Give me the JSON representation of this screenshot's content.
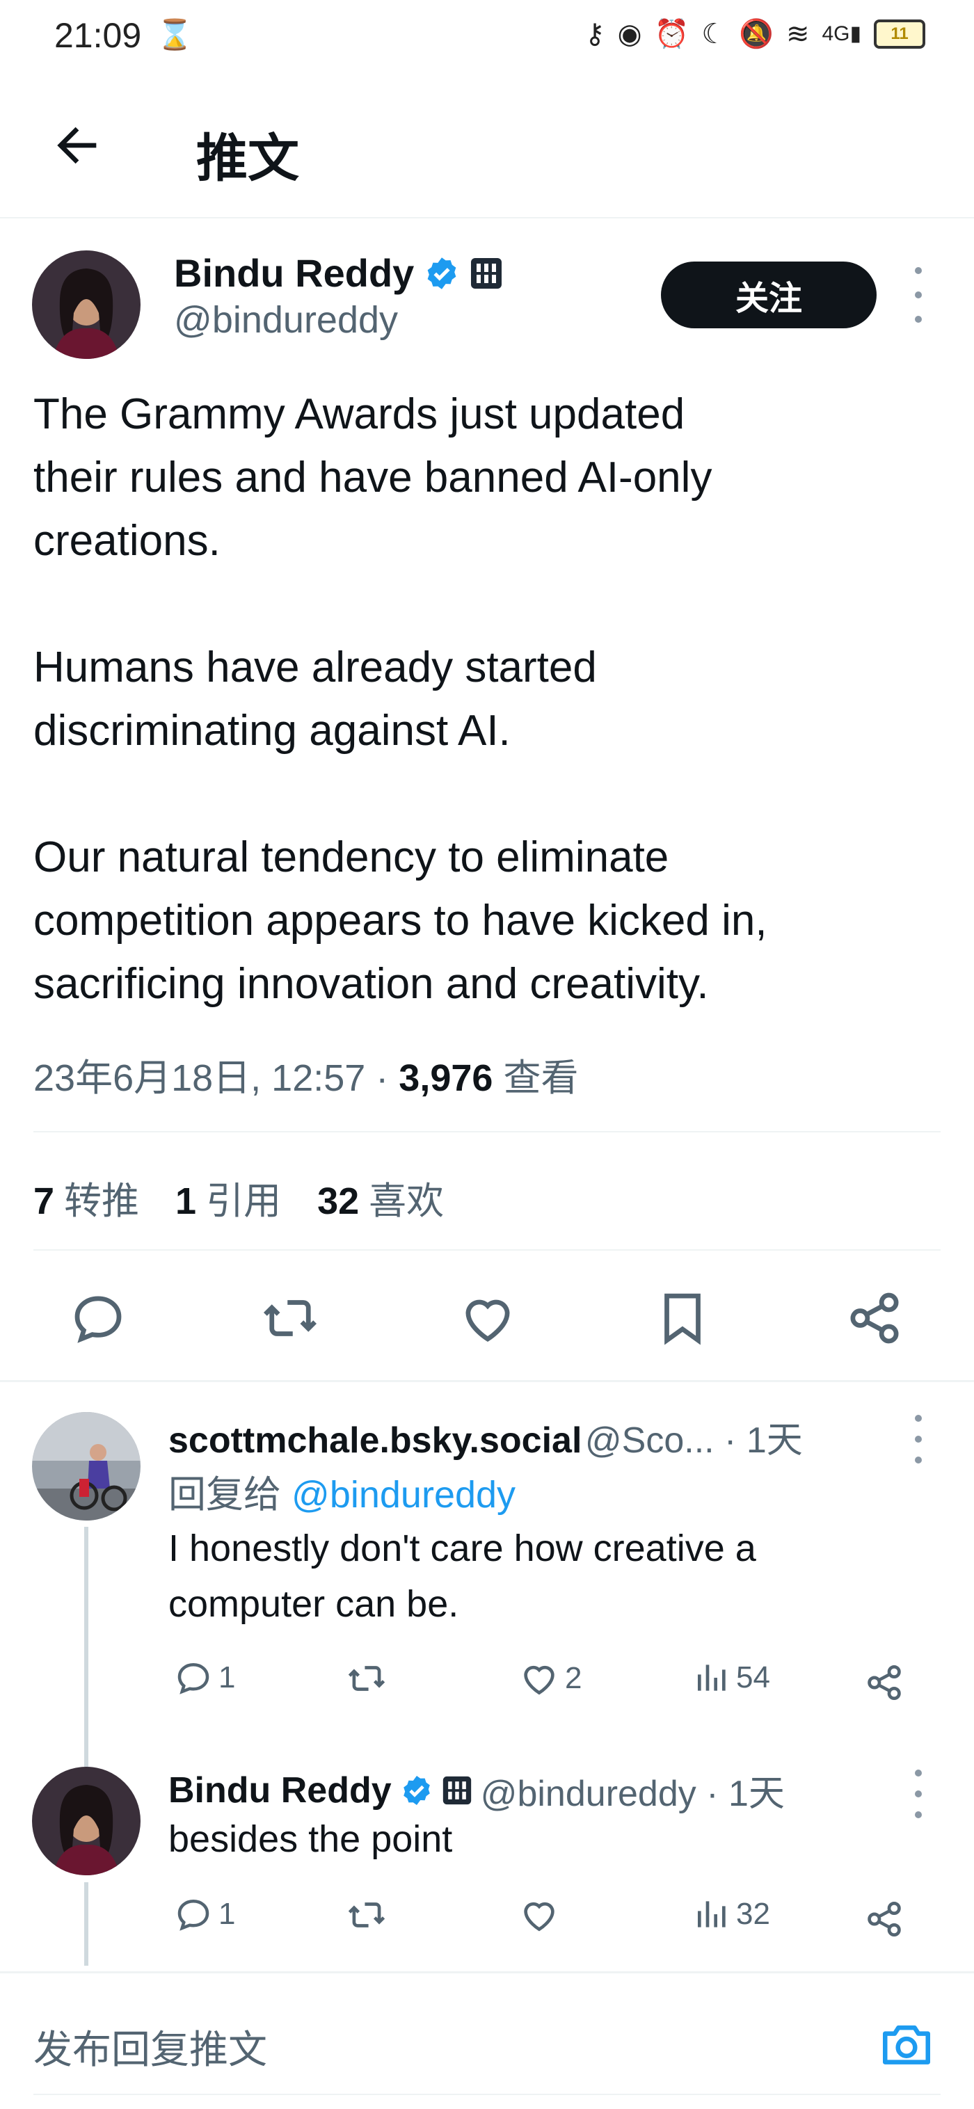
{
  "status_bar": {
    "time": "21:09",
    "battery": "11"
  },
  "header": {
    "title": "推文"
  },
  "tweet": {
    "author_name": "Bindu Reddy",
    "author_handle": "@bindureddy",
    "follow_label": "关注",
    "paragraphs": [
      "The Grammy Awards just updated their rules and have banned AI-only creations.",
      "Humans have already started discriminating against AI.",
      "Our natural tendency to eliminate competition appears to have kicked in, sacrificing innovation and creativity."
    ],
    "lines": [
      "The Grammy Awards just updated",
      "their rules and have banned AI-only",
      "creations.",
      "Humans have already started",
      "discriminating against AI.",
      "Our natural tendency to eliminate",
      "competition appears to have kicked in,",
      "sacrificing innovation and creativity."
    ],
    "timestamp": "23年6月18日, 12:57 · ",
    "views_count": "3,976",
    "views_label": "查看",
    "retweets_count": "7",
    "retweets_label": "转推",
    "quotes_count": "1",
    "quotes_label": "引用",
    "likes_count": "32",
    "likes_label": "喜欢"
  },
  "replies": [
    {
      "name": "scottmchale.bsky.social",
      "handle": "@Sco... · 1天",
      "reply_to_prefix": "回复给 ",
      "reply_to_handle": "@bindureddy",
      "text_lines": [
        "I honestly don't care how creative a",
        "computer can be."
      ],
      "reply_count": "1",
      "like_count": "2",
      "view_count": "54"
    },
    {
      "name": "Bindu Reddy",
      "handle": "@bindureddy · 1天",
      "text_lines": [
        "besides the point"
      ],
      "reply_count": "1",
      "view_count": "32"
    }
  ],
  "composer": {
    "placeholder": "发布回复推文"
  },
  "colors": {
    "accent": "#1d9bf0",
    "text": "#0f1419",
    "muted": "#536471",
    "line": "#eff3f4"
  }
}
